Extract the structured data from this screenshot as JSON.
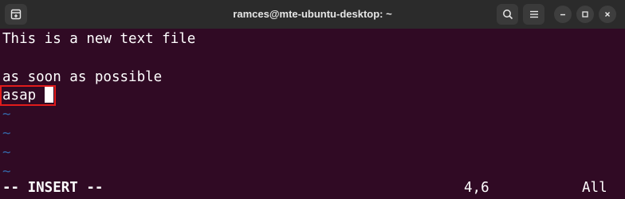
{
  "window": {
    "title": "ramces@mte-ubuntu-desktop: ~"
  },
  "icons": {
    "new_tab": "new-tab-icon",
    "search": "search-icon",
    "menu": "hamburger-menu-icon",
    "minimize": "minimize-icon",
    "maximize": "maximize-icon",
    "close": "close-icon"
  },
  "editor": {
    "lines": [
      "This is a new text file",
      "",
      "as soon as possible",
      "asap"
    ],
    "empty_marker": "~",
    "mode": "-- INSERT --",
    "cursor_position": "4,6",
    "scroll_position": "All"
  },
  "colors": {
    "background": "#300a24",
    "tilde": "#3465a4",
    "highlight": "#e11b1b"
  }
}
